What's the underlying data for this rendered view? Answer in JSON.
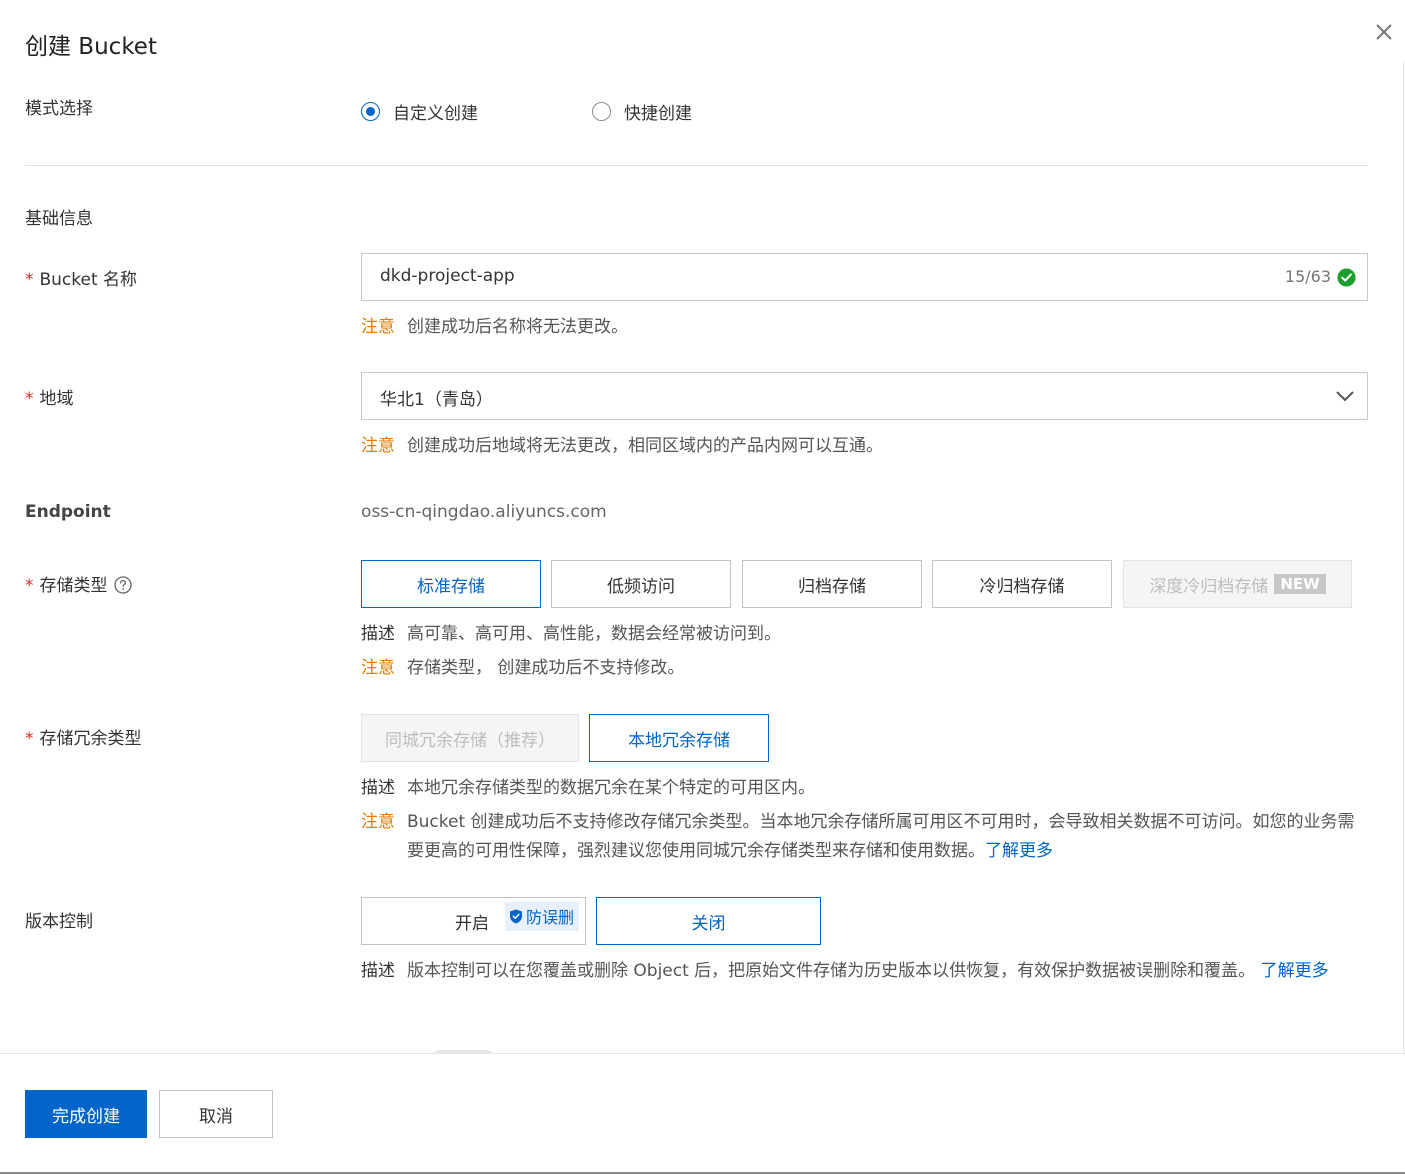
{
  "dialog": {
    "title": "创建 Bucket"
  },
  "mode": {
    "label": "模式选择",
    "options": [
      "自定义创建",
      "快捷创建"
    ],
    "selected": "自定义创建"
  },
  "basic_section": {
    "title": "基础信息"
  },
  "bucket_name": {
    "required_mark": "*",
    "label": "Bucket 名称",
    "value": "dkd-project-app",
    "counter": "15/63",
    "note_tag": "注意",
    "note": "创建成功后名称将无法更改。"
  },
  "region": {
    "required_mark": "*",
    "label": "地域",
    "value": "华北1（青岛）",
    "note_tag": "注意",
    "note": "创建成功后地域将无法更改，相同区域内的产品内网可以互通。"
  },
  "endpoint": {
    "label": "Endpoint",
    "value": "oss-cn-qingdao.aliyuncs.com"
  },
  "storage_class": {
    "required_mark": "*",
    "label": "存储类型",
    "options": [
      "标准存储",
      "低频访问",
      "归档存储",
      "冷归档存储",
      "深度冷归档存储"
    ],
    "selected": "标准存储",
    "new_badge": "NEW",
    "desc_tag": "描述",
    "desc": "高可靠、高可用、高性能，数据会经常被访问到。",
    "note_tag": "注意",
    "note": "存储类型， 创建成功后不支持修改。"
  },
  "redundancy": {
    "required_mark": "*",
    "label": "存储冗余类型",
    "options": [
      "同城冗余存储（推荐）",
      "本地冗余存储"
    ],
    "selected": "本地冗余存储",
    "desc_tag": "描述",
    "desc": "本地冗余存储类型的数据冗余在某个特定的可用区内。",
    "note_tag": "注意",
    "note": "Bucket 创建成功后不支持修改存储冗余类型。当本地冗余存储所属可用区不可用时，会导致相关数据不可访问。如您的业务需要更高的可用性保障，强烈建议您使用同城冗余存储类型来存储和使用数据。",
    "link": "了解更多"
  },
  "versioning": {
    "label": "版本控制",
    "options": [
      "开启",
      "关闭"
    ],
    "selected": "关闭",
    "tag": "防误删",
    "desc_tag": "描述",
    "desc": "版本控制可以在您覆盖或删除 Object 后，把原始文件存储为历史版本以供恢复，有效保护数据被误删除和覆盖。",
    "link": "了解更多"
  },
  "footer": {
    "submit": "完成创建",
    "cancel": "取消"
  },
  "colors": {
    "primary": "#0064c8",
    "warning": "#e07b00",
    "required": "#d93026",
    "success": "#1a9e2c"
  },
  "icons": [
    "close-icon",
    "check-circle-icon",
    "chevron-down-icon",
    "help-circle-icon",
    "shield-icon"
  ]
}
